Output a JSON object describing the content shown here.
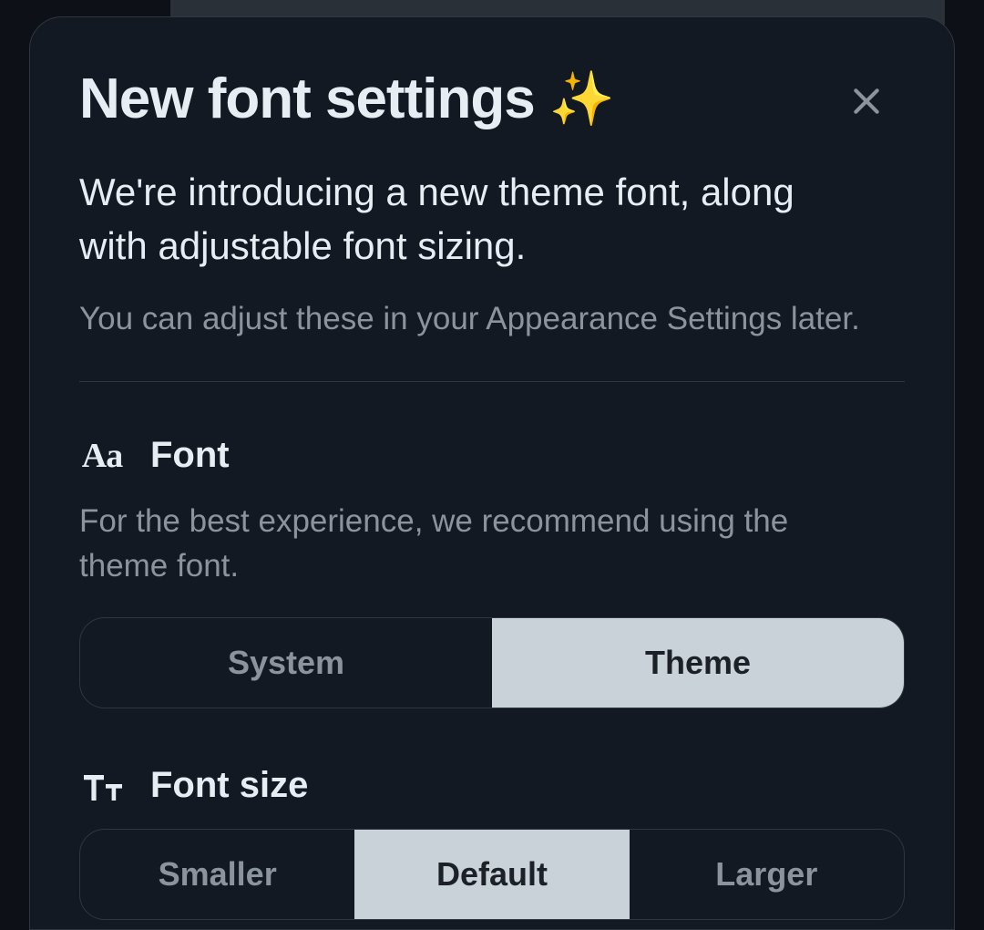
{
  "modal": {
    "title": "New font settings",
    "sparkle": "✨",
    "subtitle": "We're introducing a new theme font, along with adjustable font sizing.",
    "note": "You can adjust these in your Appearance Settings later."
  },
  "font_section": {
    "icon_label": "Aa",
    "title": "Font",
    "description": "For the best experience, we recommend using the theme font.",
    "options": {
      "system": "System",
      "theme": "Theme"
    },
    "selected": "theme"
  },
  "size_section": {
    "title": "Font size",
    "options": {
      "smaller": "Smaller",
      "default": "Default",
      "larger": "Larger"
    },
    "selected": "default"
  }
}
